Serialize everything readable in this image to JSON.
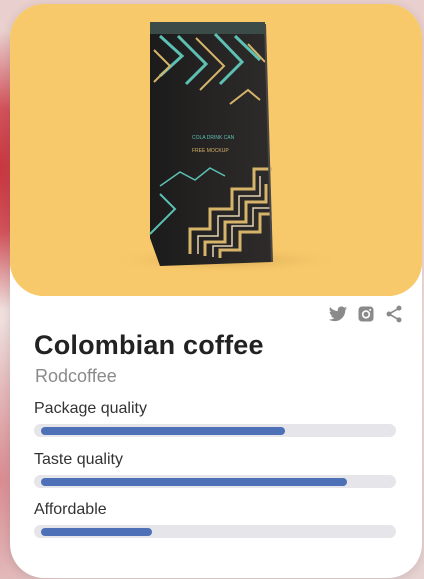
{
  "product": {
    "name": "Colombian coffee",
    "brand": "Rodcoffee",
    "package_text_1": "COLA DRINK CAN",
    "package_text_2": "FREE MOCKUP"
  },
  "share": {
    "icons": [
      "twitter-icon",
      "instagram-icon",
      "share-icon"
    ]
  },
  "ratings": [
    {
      "label": "Package quality",
      "value": 0.7
    },
    {
      "label": "Taste quality",
      "value": 0.88
    },
    {
      "label": "Affordable",
      "value": 0.32
    }
  ],
  "colors": {
    "accent": "#4d70b7",
    "track": "#e6e6ea",
    "hero_bg": "#f7c96b",
    "icon": "#8a8a8a"
  }
}
